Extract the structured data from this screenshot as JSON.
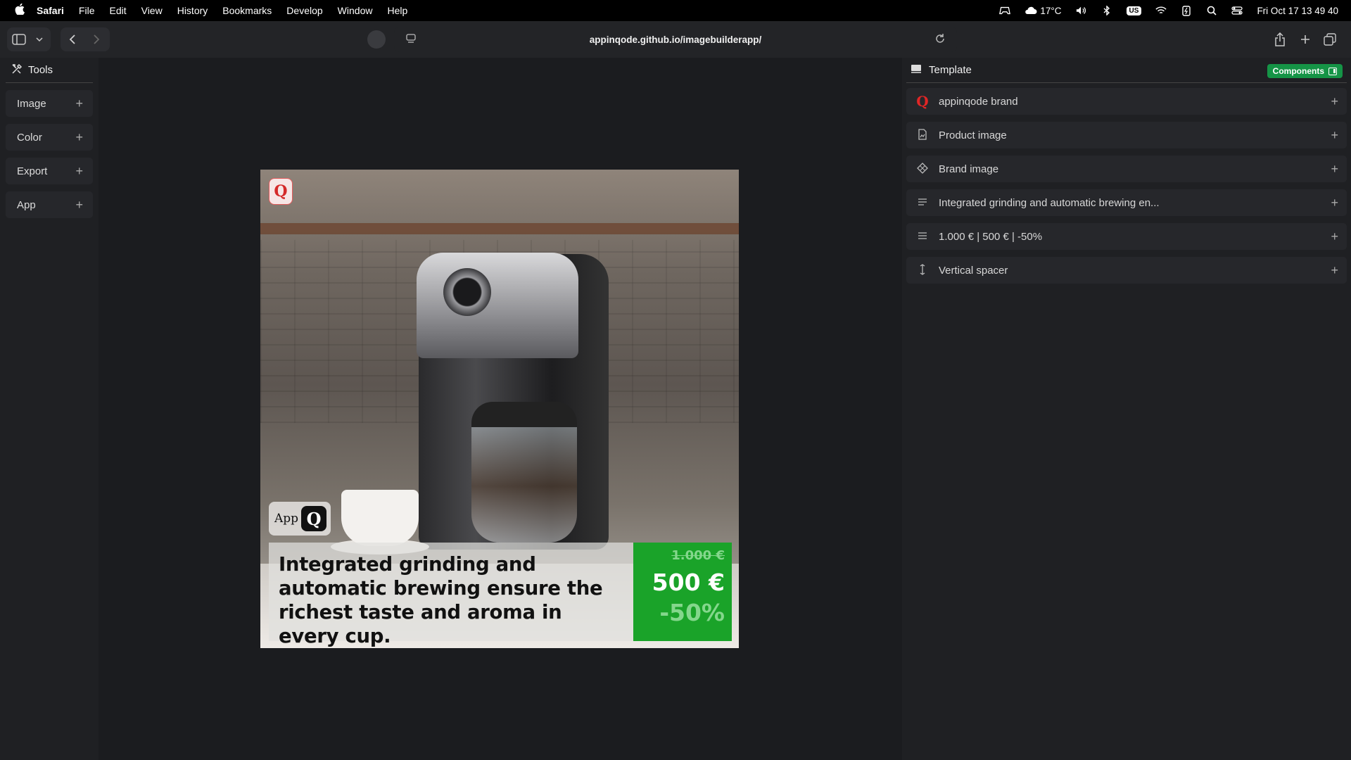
{
  "menubar": {
    "app_name": "Safari",
    "items": [
      "File",
      "Edit",
      "View",
      "History",
      "Bookmarks",
      "Develop",
      "Window",
      "Help"
    ],
    "weather": "17°C",
    "keyboard": "US",
    "datetime": "Fri Oct 17  13 49 40"
  },
  "toolbar": {
    "url": "appinqode.github.io/imagebuilderapp/"
  },
  "tools_panel": {
    "title": "Tools",
    "items": [
      {
        "label": "Image"
      },
      {
        "label": "Color"
      },
      {
        "label": "Export"
      },
      {
        "label": "App"
      }
    ]
  },
  "artboard": {
    "brand_logo_letter": "Q",
    "app_badge_text": "App",
    "app_badge_letter": "Q",
    "headline": "Integrated grinding and automatic brewing ensure the richest taste and aroma in every cup.",
    "old_price": "1.000 €",
    "new_price": "500 €",
    "discount": "-50%",
    "colors": {
      "price_box": "#1aa329",
      "brand_red": "#d42a2a"
    }
  },
  "template_panel": {
    "title": "Template",
    "components_label": "Components",
    "rows": [
      {
        "icon": "brand-q-icon",
        "label": "appinqode brand"
      },
      {
        "icon": "image-file-icon",
        "label": "Product image"
      },
      {
        "icon": "diamond-icon",
        "label": "Brand image"
      },
      {
        "icon": "text-lines-icon",
        "label": "Integrated grinding and automatic brewing en..."
      },
      {
        "icon": "text-lines-icon",
        "label": "1.000 € | 500 € | -50%"
      },
      {
        "icon": "vertical-spacer-icon",
        "label": "Vertical spacer"
      }
    ]
  }
}
